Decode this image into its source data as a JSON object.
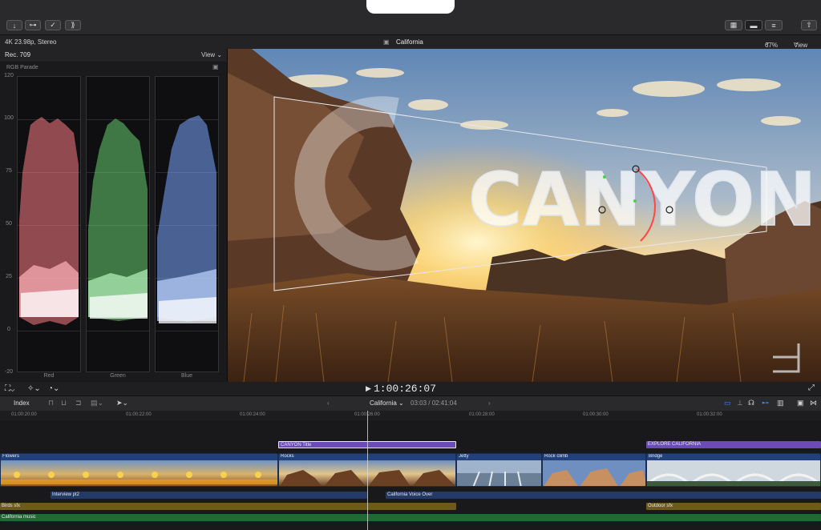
{
  "infobar": {
    "format": "4K 23.98p, Stereo",
    "project": "California",
    "zoom": "67%",
    "view_label": "View"
  },
  "scopes": {
    "title": "Rec. 709",
    "view_label": "View",
    "scope_type": "RGB Parade",
    "y_ticks": [
      "120",
      "100",
      "75",
      "50",
      "25",
      "0",
      "-20"
    ],
    "channels": [
      "Red",
      "Green",
      "Blue"
    ]
  },
  "viewer": {
    "title_text": "CANYON"
  },
  "playback": {
    "timecode": "1:00:26:07"
  },
  "timeline_toolbar": {
    "index_label": "Index",
    "project": "California",
    "duration": "03:03 / 02:41:04"
  },
  "ruler": [
    "01:00:20:00",
    "01:00:22:00",
    "01:00:24:00",
    "01:00:26:00",
    "01:00:28:00",
    "01:00:30:00",
    "01:00:32:00"
  ],
  "titles": {
    "canyon": "CANYON Title",
    "explore": "EXPLORE CALIFORNIA"
  },
  "clips": {
    "flowers": "Flowers",
    "rocks": "Rocks",
    "jetty": "Jetty",
    "rock_climb": "Rock climb",
    "bridge": "Bridge"
  },
  "audio": {
    "interview": "Interview pt2",
    "voice_over": "California Voice Over",
    "birds": "Birds sfx",
    "outdoor": "Outdoor sfx",
    "music": "California music"
  },
  "colors": {
    "title": "#6a4bb8",
    "clip": "#22407a",
    "voice": "#243a66",
    "sfx": "#6d5a1c",
    "music": "#1e6a34",
    "accent": "#3d8bff"
  }
}
